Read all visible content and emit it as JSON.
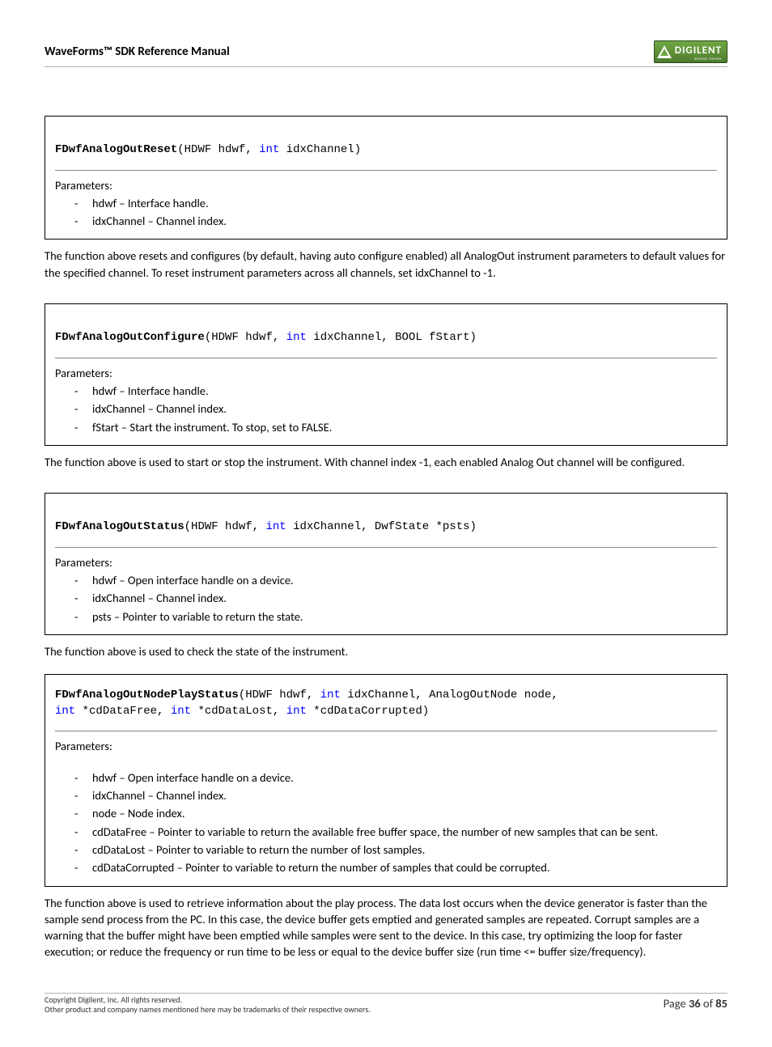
{
  "header": {
    "title": "WaveForms™ SDK Reference Manual",
    "logo_text": "DIGILENT",
    "logo_sub": "BEYOND THEORY"
  },
  "functions": [
    {
      "name": "FDwfAnalogOutReset",
      "sig_parts": [
        "(HDWF hdwf, ",
        "int",
        " idxChannel)"
      ],
      "params_label": "Parameters:",
      "params": [
        "hdwf – Interface handle.",
        "idxChannel – Channel index."
      ],
      "desc": "The function above resets and configures (by default, having auto configure enabled) all AnalogOut instrument parameters to default values for the specified channel. To reset instrument parameters across all channels, set idxChannel to -1."
    },
    {
      "name": "FDwfAnalogOutConfigure",
      "sig_parts": [
        "(HDWF hdwf, ",
        "int",
        " idxChannel, BOOL fStart)"
      ],
      "params_label": "Parameters:",
      "params": [
        "hdwf – Interface handle.",
        "idxChannel – Channel index.",
        "fStart – Start the instrument.  To stop, set to FALSE."
      ],
      "desc": "The function above is used to start or stop the instrument. With channel index -1, each enabled Analog Out channel will be configured."
    },
    {
      "name": "FDwfAnalogOutStatus",
      "sig_parts": [
        "(HDWF hdwf, ",
        "int",
        " idxChannel, DwfState *psts)"
      ],
      "params_label": "Parameters:",
      "params": [
        "hdwf – Open interface handle on a device.",
        "idxChannel – Channel index.",
        "psts – Pointer to variable to return the state."
      ],
      "desc": "The function above is used to check the state of the instrument."
    },
    {
      "name": "FDwfAnalogOutNodePlayStatus",
      "sig_parts": [
        "(HDWF hdwf, ",
        "int",
        " idxChannel, AnalogOutNode node, \n",
        "int",
        " *cdDataFree, ",
        "int",
        " *cdDataLost, ",
        "int",
        " *cdDataCorrupted)"
      ],
      "params_label": "Parameters:",
      "params": [
        "hdwf – Open interface handle on a device.",
        "idxChannel – Channel index.",
        "node – Node index.",
        "cdDataFree – Pointer to variable to return the available free buffer space, the number of new samples that can be sent.",
        "cdDataLost – Pointer to variable to return the number of lost samples.",
        "cdDataCorrupted – Pointer to variable to return the number of samples that could be corrupted."
      ],
      "desc": "The function above is used to retrieve information about the play process.  The data lost occurs when the device generator is faster than the sample send process from the PC. In this case, the device buffer gets emptied and generated samples are repeated.  Corrupt samples are a warning that the buffer might have been emptied while samples were sent to the device.  In this case, try optimizing the loop for faster execution; or reduce the frequency or run time to be less or equal to the device buffer size (run time <= buffer size/frequency)."
    }
  ],
  "footer": {
    "copyright": "Copyright Digilent, Inc. All rights reserved.",
    "trademark": "Other product and company names mentioned here may be trademarks of their respective owners.",
    "page_label": "Page ",
    "page_num": "36",
    "page_of": " of ",
    "page_total": "85"
  }
}
